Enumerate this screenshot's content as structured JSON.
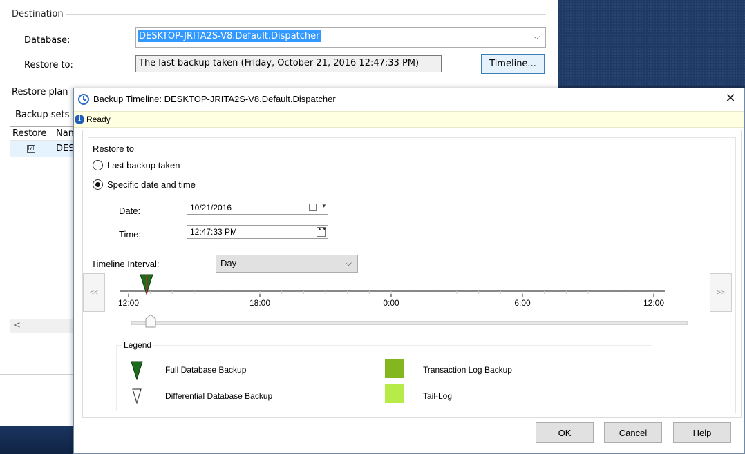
{
  "background_window": {
    "destination_legend": "Destination",
    "database_label": "Database:",
    "database_value": "DESKTOP-JRITA2S-V8.Default.Dispatcher",
    "restore_to_label": "Restore to:",
    "restore_to_value": "The last backup taken (Friday, October 21, 2016 12:47:33 PM)",
    "timeline_button": "Timeline...",
    "restore_plan_label": "Restore plan",
    "backup_sets_label": "Backup sets t",
    "grid": {
      "columns": [
        "Restore",
        "Nam"
      ],
      "rows": [
        {
          "checked": true,
          "check_glyph": "☑",
          "name": "DES"
        }
      ],
      "scroll_left_glyph": "<"
    }
  },
  "dialog": {
    "title": "Backup Timeline: DESKTOP-JRITA2S-V8.Default.Dispatcher",
    "close_glyph": "✕",
    "status_icon_glyph": "i",
    "status": "Ready",
    "restore_to_group": "Restore to",
    "options": {
      "last_backup": "Last backup taken",
      "specific": "Specific date and time",
      "selected": "specific"
    },
    "date_label": "Date:",
    "date_value": "10/21/2016",
    "date_dropdown_glyph": "▾",
    "time_label": "Time:",
    "time_value": "12:47:33 PM",
    "time_spinner_glyph": "▲▼",
    "interval_label": "Timeline Interval:",
    "interval_value": "Day",
    "interval_chevron": "⌵",
    "nav_prev": "<<",
    "nav_next": ">>",
    "timeline_ticks": [
      "12:00",
      "18:00",
      "0:00",
      "6:00",
      "12:00"
    ],
    "legend": {
      "title": "Legend",
      "full_backup": "Full Database Backup",
      "differential": "Differential Database Backup",
      "transaction_log": "Transaction Log Backup",
      "tail_log": "Tail-Log"
    },
    "buttons": {
      "ok": "OK",
      "cancel": "Cancel",
      "help": "Help"
    }
  },
  "colors": {
    "full_backup_marker": "#1e6b1e",
    "transaction_log": "#84b71f",
    "tail_log": "#b6eb48",
    "selection_highlight": "#3399ff",
    "status_bar_bg": "#ffffe1",
    "time_marker_line": "#d11f1f"
  },
  "icons": {
    "title_icon": "clock-icon",
    "status_icon": "info-icon",
    "date_picker": "calendar-icon",
    "close": "close-icon"
  }
}
